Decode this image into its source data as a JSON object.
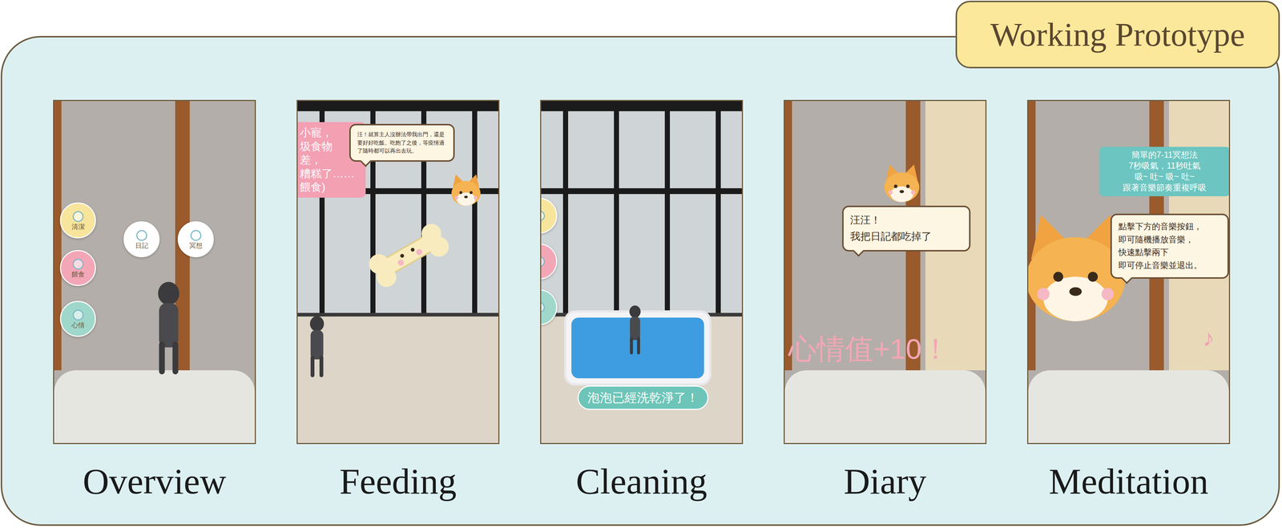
{
  "badge": "Working Prototype",
  "screens": [
    {
      "label": "Overview",
      "scene": "bedroom",
      "menu": [
        {
          "label": "清潔",
          "color": "#f8e59c"
        },
        {
          "label": "餵食",
          "color": "#f3a6b6"
        },
        {
          "label": "心情",
          "color": "#9fd8cb"
        },
        {
          "label": "日記",
          "color": "#ffffff"
        },
        {
          "label": "冥想",
          "color": "#ffffff"
        }
      ]
    },
    {
      "label": "Feeding",
      "scene": "balcony",
      "side_panel": [
        "小寵，",
        "圾食物",
        "差，",
        "糟糕了……",
        "餵食)"
      ],
      "bubble": [
        "汪！就算主人沒辦法帶我出門，還是要好好吃飯。吃飽了之後，等疫情過了隨時都可以再出去玩。"
      ]
    },
    {
      "label": "Cleaning",
      "scene": "balcony",
      "menu": [
        {
          "color": "#f8e59c"
        },
        {
          "color": "#f3a6b6"
        },
        {
          "color": "#9fd8cb"
        }
      ],
      "toast": "泡泡已經洗乾淨了！"
    },
    {
      "label": "Diary",
      "scene": "bedroom",
      "bubble": [
        "汪汪！",
        "我把日記都吃掉了"
      ],
      "float_text": "心情值+10！"
    },
    {
      "label": "Meditation",
      "scene": "bedroom",
      "info_panel": [
        "簡單的7-11冥想法",
        "7秒吸氣，11秒吐氣",
        "吸~ 吐~ 吸~ 吐~",
        "跟著音樂節奏重複呼吸"
      ],
      "bubble": [
        "點擊下方的音樂按鈕，",
        "即可隨機播放音樂，",
        "快速點擊兩下",
        "即可停止音樂並退出。"
      ],
      "note": "♪"
    }
  ]
}
